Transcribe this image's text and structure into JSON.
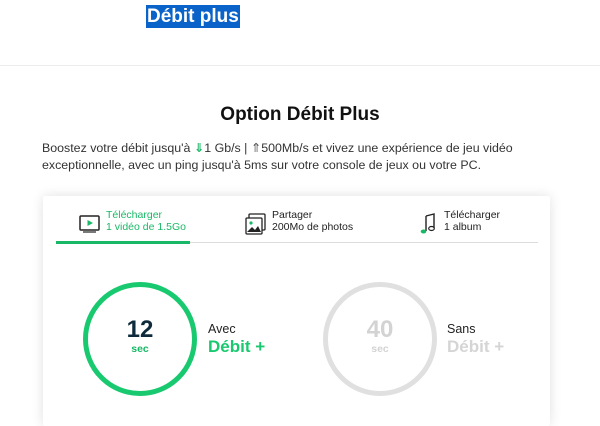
{
  "header": {
    "title": "Débit plus"
  },
  "section": {
    "title": "Option Débit Plus",
    "intro_part1": "Boostez votre débit jusqu'à ",
    "down_arrow": "⇓",
    "down_speed": "1 Gb/s | ",
    "up_arrow": "⇑",
    "intro_part2": "500Mb/s et vivez une expérience de jeu vidéo exceptionnelle, avec un ping jusqu'à 5ms sur votre console de jeux ou votre PC."
  },
  "tabs": [
    {
      "line1": "Télécharger",
      "line2": "1 vidéo de 1.5Go",
      "icon": "video-icon",
      "active": true
    },
    {
      "line1": "Partager",
      "line2": "200Mo de photos",
      "icon": "photos-icon",
      "active": false
    },
    {
      "line1": "Télécharger",
      "line2": "1 album",
      "icon": "music-note-icon",
      "active": false
    }
  ],
  "comparison": {
    "with": {
      "value": "12",
      "unit": "sec",
      "label": "Avec",
      "name": "Débit +",
      "color": "#19c96f"
    },
    "without": {
      "value": "40",
      "unit": "sec",
      "label": "Sans",
      "name": "Débit +",
      "color": "#d5d5d5"
    }
  },
  "colors": {
    "accent": "#19b866",
    "highlight": "#0a63c9"
  }
}
